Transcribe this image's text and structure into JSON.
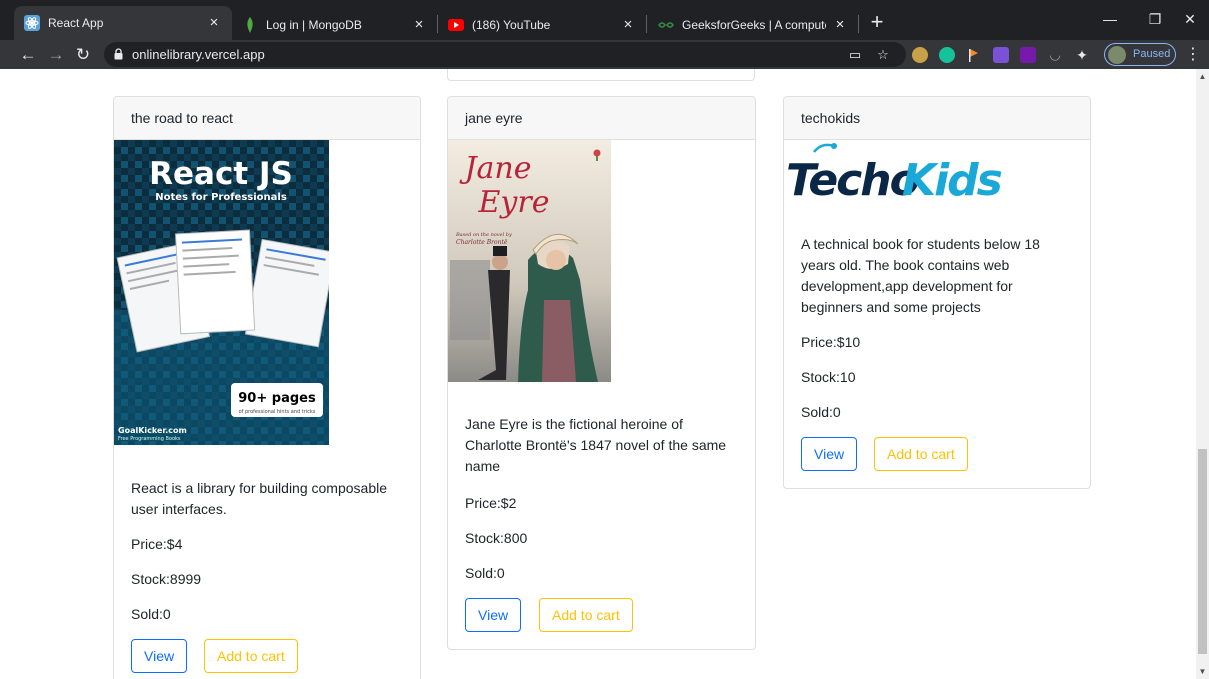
{
  "browser": {
    "tabs": [
      {
        "title": "React App",
        "favicon": "react-icon",
        "active": true
      },
      {
        "title": "Log in | MongoDB",
        "favicon": "mongodb-leaf-icon",
        "active": false
      },
      {
        "title": "(186) YouTube",
        "favicon": "youtube-icon",
        "active": false
      },
      {
        "title": "GeeksforGeeks | A computer scie",
        "favicon": "geeksforgeeks-icon",
        "active": false
      }
    ],
    "url": "onlinelibrary.vercel.app",
    "profile_status": "Paused"
  },
  "books": [
    {
      "title": "the road to react",
      "cover": {
        "heading": "React JS",
        "subheading": "Notes for Professionals",
        "badge": "90+ pages",
        "badge_sub": "of professional hints and tricks",
        "footer": "GoalKicker.com",
        "footer_sub": "Free Programming Books"
      },
      "description": "React is a library for building composable user interfaces.",
      "price": "Price:$4",
      "stock": "Stock:8999",
      "sold": "Sold:0",
      "view_label": "View",
      "cart_label": "Add to cart"
    },
    {
      "title": "jane eyre",
      "cover": {
        "heading_line1": "Jane",
        "heading_line2": "Eyre",
        "byline1": "Based on the novel by",
        "byline2": "Charlotte Brontë"
      },
      "description": "Jane Eyre is the fictional heroine of Charlotte Brontë's 1847 novel of the same name",
      "price": "Price:$2",
      "stock": "Stock:800",
      "sold": "Sold:0",
      "view_label": "View",
      "cart_label": "Add to cart"
    },
    {
      "title": "techokids",
      "cover": {
        "logo_part1": "Techo",
        "logo_part2": "Kids"
      },
      "description": "A technical book for students below 18 years old. The book contains web development,app development for beginners and some projects",
      "price": "Price:$10",
      "stock": "Stock:10",
      "sold": "Sold:0",
      "view_label": "View",
      "cart_label": "Add to cart"
    }
  ],
  "colors": {
    "view_button": "#0d6efd",
    "cart_button": "#ffc107",
    "card_header_bg": "#f7f7f7"
  }
}
